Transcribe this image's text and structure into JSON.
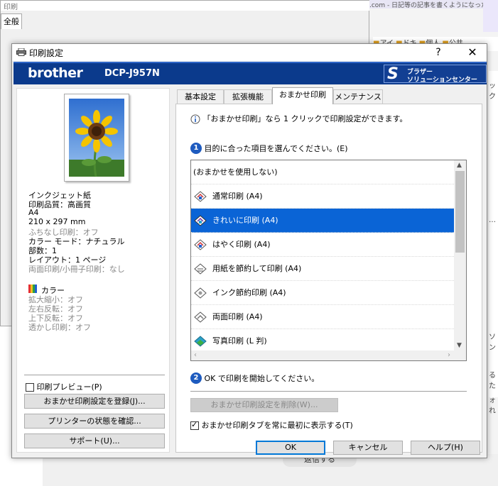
{
  "background": {
    "window_title": "印刷",
    "tab_label": "全般",
    "right_top_text": ".com - 日記等の記事を書くようになった",
    "right_bar_items": [
      "アイ",
      "ドキ",
      "個人",
      "公共"
    ],
    "right_side_glyphs": [
      "ック",
      "…",
      "ソン",
      "るた",
      "ォれ"
    ],
    "bottom_button_label": "返信する"
  },
  "dialog": {
    "title": "印刷設定",
    "help_label": "?",
    "close_label": "✕",
    "brand": {
      "logo_text": "brother",
      "model": "DCP-J957N",
      "solution_button_line1": "ブラザー",
      "solution_button_line2": "ソリューションセンター"
    },
    "left_panel": {
      "settings_dark": [
        "インクジェット紙",
        "印刷品質：高画質",
        "A4"
      ],
      "paper_size": "210 x 297 mm",
      "borderless": "ふちなし印刷：オフ",
      "color_mode": "カラー モード：ナチュラル",
      "copies": "部数：1",
      "layout": "レイアウト：1 ページ",
      "duplex": "両面印刷/小冊子印刷：なし",
      "color_label": "カラー",
      "color_options": [
        "拡大縮小：オフ",
        "左右反転：オフ",
        "上下反転：オフ",
        "透かし印刷：オフ"
      ],
      "print_preview_label": "印刷プレビュー(P)",
      "print_preview_checked": false,
      "register_button": "おまかせ印刷設定を登録(J)...",
      "printer_status_button": "プリンターの状態を確認...",
      "support_button": "サポート(U)..."
    },
    "tabs": [
      {
        "label": "基本設定",
        "active": false
      },
      {
        "label": "拡張機能",
        "active": false
      },
      {
        "label": "おまかせ印刷",
        "active": true
      },
      {
        "label": "メンテナンス",
        "active": false
      }
    ],
    "omakase": {
      "info_text": "「おまかせ印刷」なら 1 クリックで印刷設定ができます。",
      "step1_number": "1",
      "step1_text": "目的に合った項目を選んでください。(E)",
      "list_items": [
        {
          "label": "(おまかせを使用しない)",
          "icon": "",
          "selected": false
        },
        {
          "label": "通常印刷 (A4)",
          "icon": "print-normal-icon",
          "selected": false
        },
        {
          "label": "きれいに印刷 (A4)",
          "icon": "print-fine-icon",
          "selected": true
        },
        {
          "label": "はやく印刷 (A4)",
          "icon": "print-fast-icon",
          "selected": false
        },
        {
          "label": "用紙を節約して印刷 (A4)",
          "icon": "paper-save-icon",
          "selected": false
        },
        {
          "label": "インク節約印刷 (A4)",
          "icon": "ink-save-icon",
          "selected": false
        },
        {
          "label": "両面印刷 (A4)",
          "icon": "duplex-icon",
          "selected": false
        },
        {
          "label": "写真印刷 (L 判)",
          "icon": "photo-icon",
          "selected": false
        }
      ],
      "step2_number": "2",
      "step2_text": "OK で印刷を開始してください。",
      "delete_button": "おまかせ印刷設定を削除(W)...",
      "always_show_label": "おまかせ印刷タブを常に最初に表示する(T)",
      "always_show_checked": true
    },
    "buttons": {
      "ok": "OK",
      "cancel": "キャンセル",
      "help": "ヘルプ(H)"
    },
    "colors": {
      "brand_blue": "#0b3a8c",
      "selection_blue": "#0a64d6",
      "step_blue": "#1e5bbf"
    }
  }
}
